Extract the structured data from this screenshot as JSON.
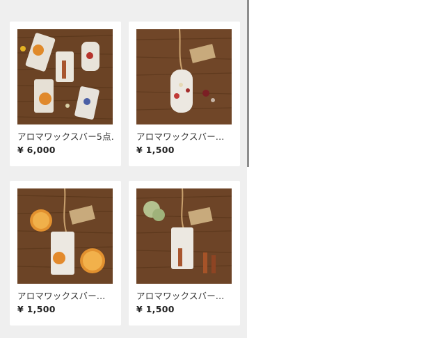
{
  "products": [
    {
      "name": "アロマワックスバー5点...",
      "price": "¥ 6,000",
      "image": "five-aroma-wax-bars-photo"
    },
    {
      "name": "アロマワックスバー...",
      "price": "¥ 1,500",
      "image": "rose-wax-bar-with-tag-photo"
    },
    {
      "name": "アロマワックスバー...",
      "price": "¥ 1,500",
      "image": "orange-slice-wax-bar-photo"
    },
    {
      "name": "アロマワックスバー...",
      "price": "¥ 1,500",
      "image": "cinnamon-wax-bar-photo"
    }
  ],
  "colors": {
    "wood": "#6e4526",
    "page_background": "#efefef",
    "card_background": "#ffffff"
  }
}
